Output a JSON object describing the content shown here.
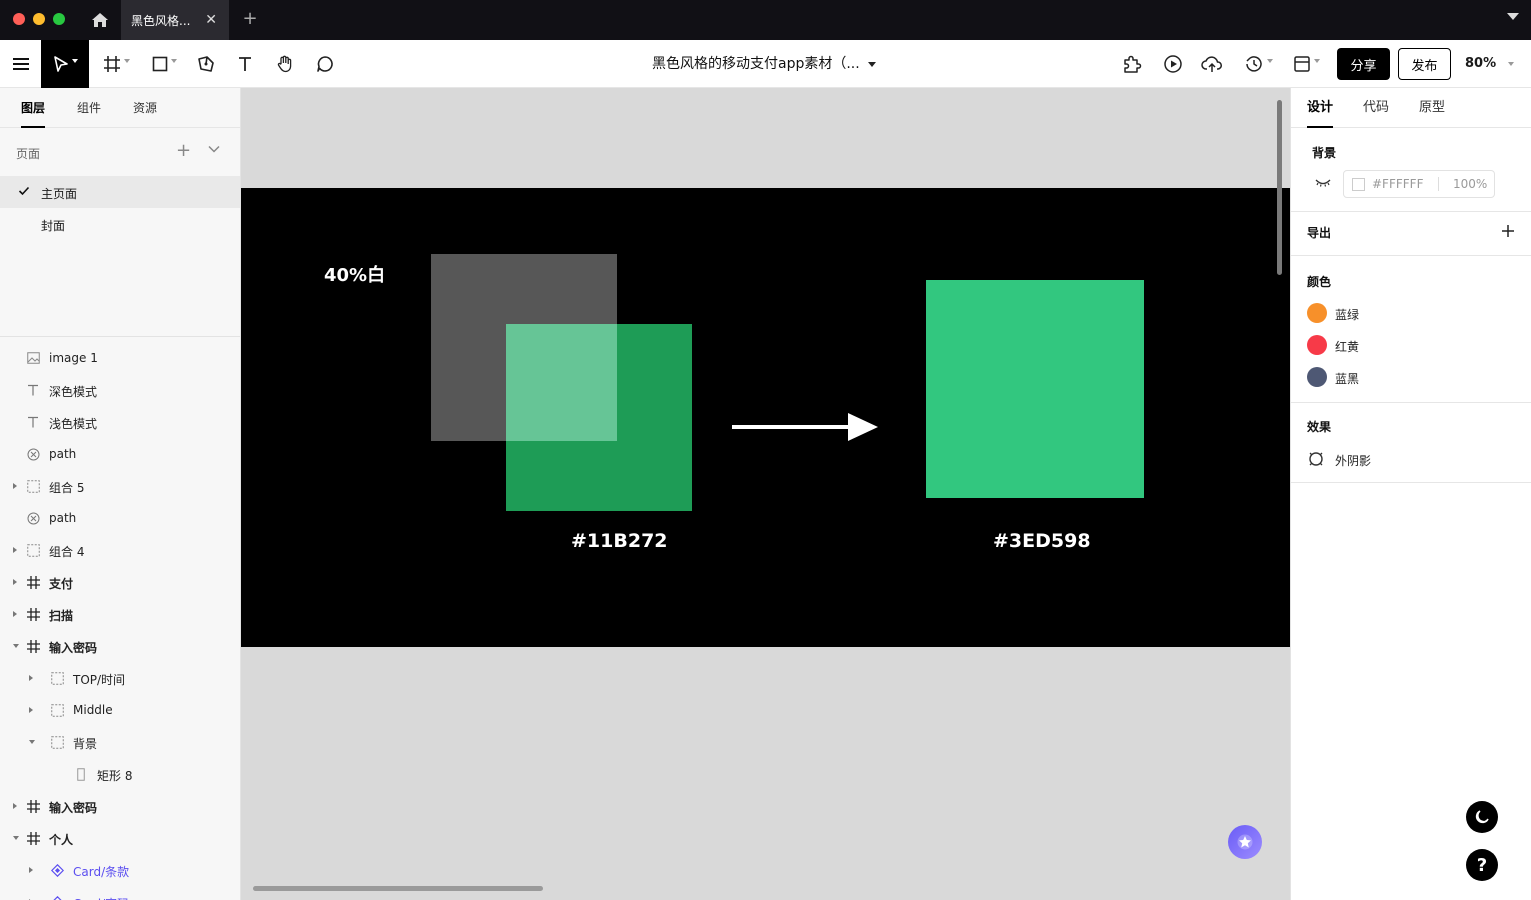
{
  "titlebar": {
    "tab_title": "黑色风格...",
    "tab_close": "✕",
    "new_tab": "+"
  },
  "toolbar": {
    "doc_title": "黑色风格的移动支付app素材（...",
    "share_label": "分享",
    "publish_label": "发布",
    "zoom": "80%"
  },
  "left_panel": {
    "tabs": [
      "图层",
      "组件",
      "资源"
    ],
    "pages_title": "页面",
    "pages_add": "+",
    "pages": [
      {
        "label": "主页面",
        "selected": true
      },
      {
        "label": "封面",
        "selected": false
      }
    ],
    "layers": [
      {
        "name": "image 1",
        "icon": "image-icon",
        "indent": 0,
        "arrow": "none",
        "bold": false,
        "component": false
      },
      {
        "name": "深色模式",
        "icon": "text-icon",
        "indent": 0,
        "arrow": "none",
        "bold": false,
        "component": false
      },
      {
        "name": "浅色模式",
        "icon": "text-icon",
        "indent": 0,
        "arrow": "none",
        "bold": false,
        "component": false
      },
      {
        "name": "path",
        "icon": "path-icon",
        "indent": 0,
        "arrow": "none",
        "bold": false,
        "component": false
      },
      {
        "name": "组合 5",
        "icon": "group-icon",
        "indent": 0,
        "arrow": "right",
        "bold": false,
        "component": false
      },
      {
        "name": "path",
        "icon": "path-icon",
        "indent": 0,
        "arrow": "none",
        "bold": false,
        "component": false
      },
      {
        "name": "组合 4",
        "icon": "group-icon",
        "indent": 0,
        "arrow": "right",
        "bold": false,
        "component": false
      },
      {
        "name": "支付",
        "icon": "frame-icon",
        "indent": 0,
        "arrow": "right",
        "bold": true,
        "component": false
      },
      {
        "name": "扫描",
        "icon": "frame-icon",
        "indent": 0,
        "arrow": "right",
        "bold": true,
        "component": false
      },
      {
        "name": "输入密码",
        "icon": "frame-icon",
        "indent": 0,
        "arrow": "down",
        "bold": true,
        "component": false
      },
      {
        "name": "TOP/时间",
        "icon": "group-icon",
        "indent": 1,
        "arrow": "right",
        "bold": false,
        "component": false
      },
      {
        "name": "Middle",
        "icon": "group-icon",
        "indent": 1,
        "arrow": "right",
        "bold": false,
        "component": false
      },
      {
        "name": "背景",
        "icon": "group-icon",
        "indent": 1,
        "arrow": "down",
        "bold": false,
        "component": false
      },
      {
        "name": "矩形 8",
        "icon": "rect-icon",
        "indent": 2,
        "arrow": "none",
        "bold": false,
        "component": false
      },
      {
        "name": "输入密码",
        "icon": "frame-icon",
        "indent": 0,
        "arrow": "right",
        "bold": true,
        "component": false
      },
      {
        "name": "个人",
        "icon": "frame-icon",
        "indent": 0,
        "arrow": "down",
        "bold": true,
        "component": false
      },
      {
        "name": "Card/条款",
        "icon": "component-icon",
        "indent": 1,
        "arrow": "right",
        "bold": false,
        "component": true
      },
      {
        "name": "Card/密码",
        "icon": "component-icon",
        "indent": 1,
        "arrow": "right",
        "bold": false,
        "component": true
      }
    ]
  },
  "canvas": {
    "overlay_label": "40%白",
    "hex_before": "#11B272",
    "hex_after": "#3ED598",
    "colors": {
      "grey_square": "#575757",
      "green_square": "#1E9C56",
      "overlap": "#66C596",
      "result_square": "#32C77F"
    }
  },
  "right_panel": {
    "tabs": [
      "设计",
      "代码",
      "原型"
    ],
    "background_title": "背景",
    "background_hex": "#FFFFFF",
    "background_opacity": "100%",
    "export_title": "导出",
    "export_add": "+",
    "colors_title": "颜色",
    "colors": [
      {
        "name": "蓝绿",
        "swatch": "#F7902A"
      },
      {
        "name": "红黄",
        "swatch": "#F73A48"
      },
      {
        "name": "蓝黑",
        "swatch": "#4E5874"
      }
    ],
    "effects_title": "效果",
    "effect_name": "外阴影",
    "help_label": "?"
  }
}
